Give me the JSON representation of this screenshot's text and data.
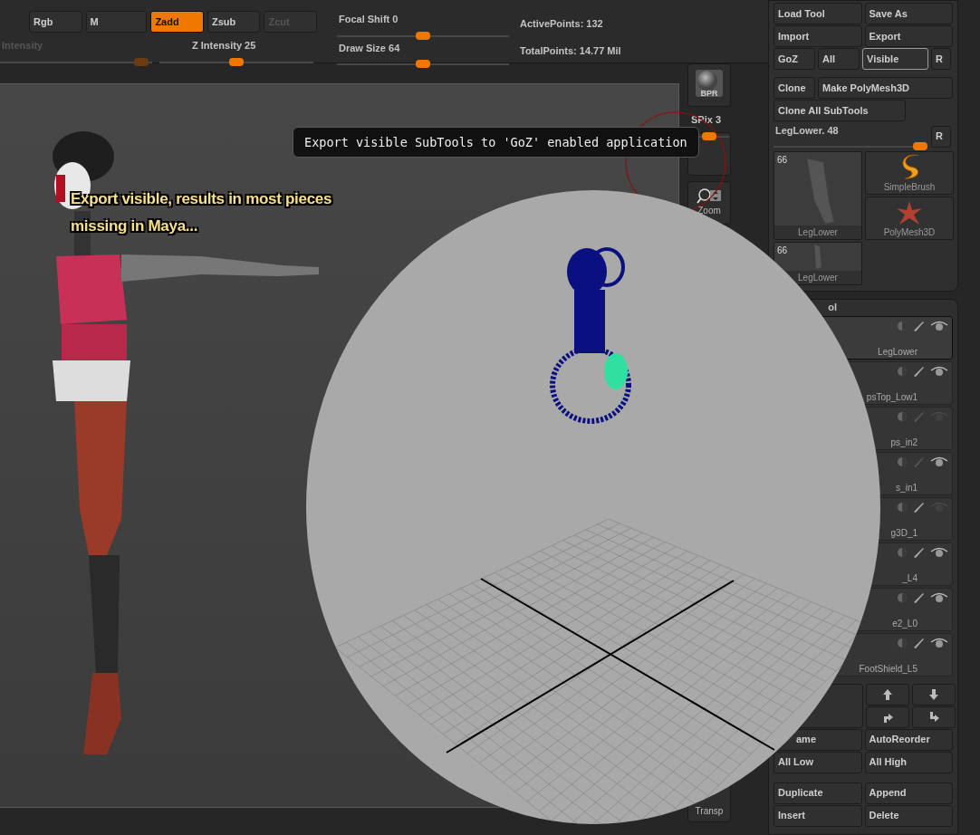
{
  "top_bar": {
    "buttons": [
      {
        "label": "Rgb",
        "selected": false,
        "disabled": false
      },
      {
        "label": "M",
        "selected": false,
        "disabled": false
      },
      {
        "label": "Zadd",
        "selected": true,
        "disabled": false
      },
      {
        "label": "Zsub",
        "selected": false,
        "disabled": false
      },
      {
        "label": "Zcut",
        "selected": false,
        "disabled": true
      }
    ],
    "sliders": [
      {
        "label": "Intensity",
        "level": 0.93,
        "disabled": true
      },
      {
        "label": "Z Intensity 25",
        "level": 0.5,
        "disabled": false
      },
      {
        "label": "Focal Shift 0",
        "level": 0.5,
        "disabled": false
      },
      {
        "label": "Draw Size 64",
        "level": 0.5,
        "disabled": false
      }
    ],
    "stats": [
      "ActivePoints: 132",
      "TotalPoints: 14.77 Mil"
    ]
  },
  "annotation": "Export visible, results in most pieces missing in Maya...",
  "tooltip": "Export visible SubTools to 'GoZ' enabled application",
  "side_toolbar": [
    {
      "kind": "render",
      "label": "BPR"
    },
    {
      "kind": "slider",
      "label": "SPix 3",
      "level": 0.5
    },
    {
      "kind": "blank"
    },
    {
      "kind": "zoom",
      "label": "Zoom"
    },
    {
      "kind": "spacer"
    },
    {
      "kind": "transparency",
      "label": "Transp"
    }
  ],
  "tool_panel": {
    "rows": [
      [
        {
          "label": "Load Tool",
          "selected": false
        },
        {
          "label": "Save As",
          "selected": false
        }
      ],
      [
        {
          "label": "Import",
          "selected": false
        },
        {
          "label": "Export",
          "selected": false
        }
      ],
      [
        {
          "label": "GoZ",
          "selected": false
        },
        {
          "label": "All",
          "selected": false
        },
        {
          "label": "Visible",
          "selected": true
        },
        {
          "label": "R",
          "selected": false
        }
      ],
      [
        {
          "label": "Clone",
          "selected": false
        },
        {
          "label": "Make PolyMesh3D",
          "selected": false
        }
      ],
      [
        {
          "label": "Clone All SubTools",
          "selected": false
        }
      ]
    ],
    "slider": {
      "label": "LegLower. 48",
      "level": 0.95,
      "reset": "R"
    },
    "tools": [
      {
        "kind": "mesh",
        "label": "LegLower",
        "count": "66"
      },
      {
        "kind": "brush",
        "label": "SimpleBrush"
      },
      {
        "kind": "star",
        "label": "PolyMesh3D"
      },
      {
        "kind": "mesh",
        "label": "LegLower",
        "count": "66"
      }
    ]
  },
  "subtool_panel": {
    "title": "ol",
    "rows": [
      {
        "name": "LegLower",
        "selected": true,
        "visible": true,
        "editable": true
      },
      {
        "name": "psTop_Low1",
        "selected": false,
        "visible": true,
        "editable": true
      },
      {
        "name": "ps_in2",
        "selected": false,
        "visible": false,
        "editable": false
      },
      {
        "name": "s_in1",
        "selected": false,
        "visible": true,
        "editable": false
      },
      {
        "name": "g3D_1",
        "selected": false,
        "visible": false,
        "editable": true
      },
      {
        "name": "_L4",
        "selected": false,
        "visible": true,
        "editable": true
      },
      {
        "name": "e2_L0",
        "selected": false,
        "visible": true,
        "editable": true
      },
      {
        "name": "FootShield_L5",
        "selected": false,
        "visible": true,
        "editable": true
      }
    ],
    "buttons": [
      [
        "ame",
        "AutoReorder"
      ],
      [
        "All Low",
        "All High"
      ],
      [
        "Duplicate",
        "Append"
      ],
      [
        "Insert",
        "Delete"
      ]
    ]
  }
}
